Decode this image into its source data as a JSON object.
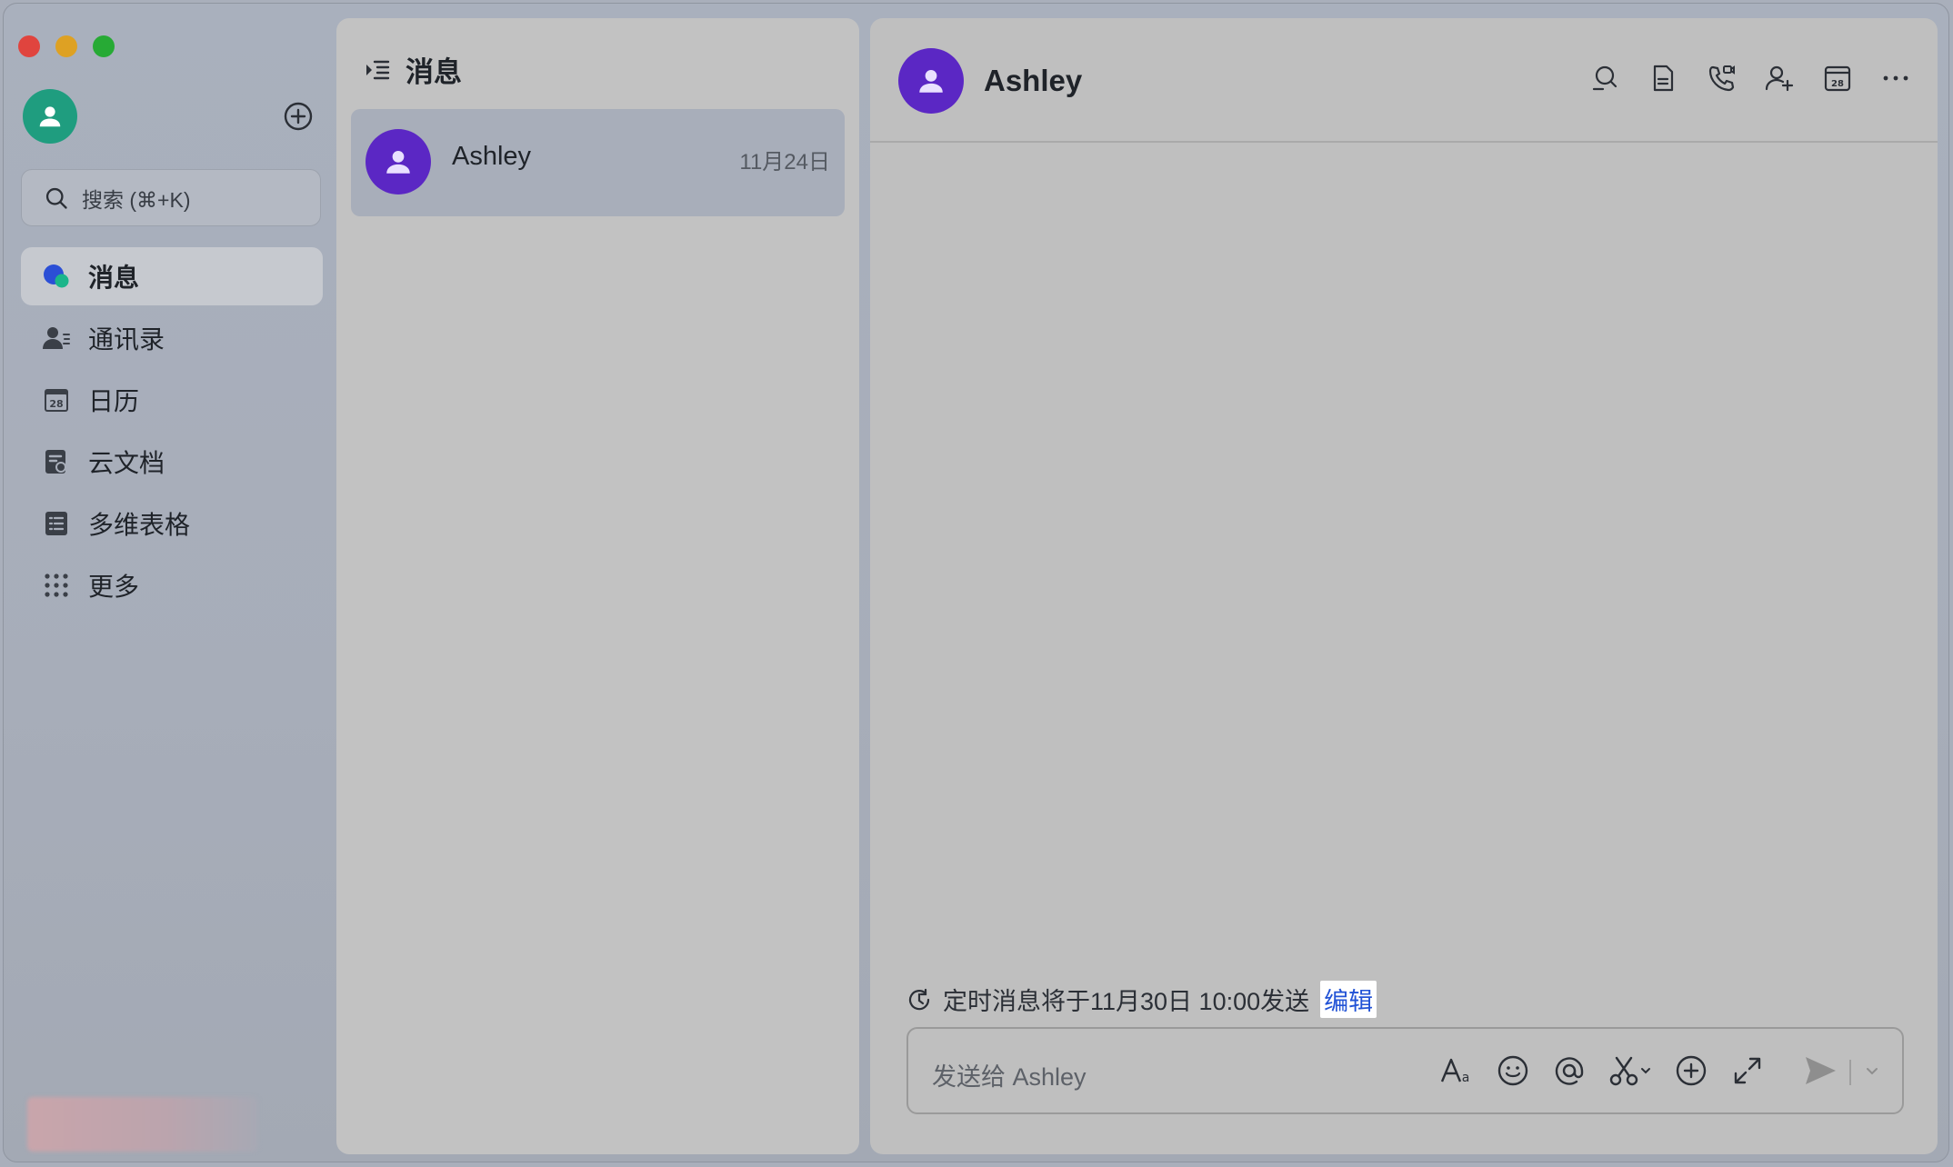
{
  "sidebar": {
    "search_placeholder": "搜索 (⌘+K)",
    "items": [
      {
        "label": "消息",
        "icon": "chat-bubbles-icon",
        "active": true
      },
      {
        "label": "通讯录",
        "icon": "contacts-icon",
        "active": false
      },
      {
        "label": "日历",
        "icon": "calendar-icon",
        "active": false
      },
      {
        "label": "云文档",
        "icon": "cloud-doc-icon",
        "active": false
      },
      {
        "label": "多维表格",
        "icon": "base-table-icon",
        "active": false
      },
      {
        "label": "更多",
        "icon": "more-grid-icon",
        "active": false
      }
    ],
    "calendar_day": "28"
  },
  "list": {
    "title": "消息",
    "conversations": [
      {
        "name": "Ashley",
        "date": "11月24日"
      }
    ]
  },
  "chat": {
    "contact_name": "Ashley",
    "scheduled_text": "定时消息将于11月30日 10:00发送",
    "edit_label": "编辑",
    "input_placeholder": "发送给 Ashley",
    "calendar_day": "28"
  },
  "colors": {
    "accent_blue": "#2253d6",
    "avatar_purple": "#5b27c4",
    "avatar_green": "#1f9d7f"
  }
}
